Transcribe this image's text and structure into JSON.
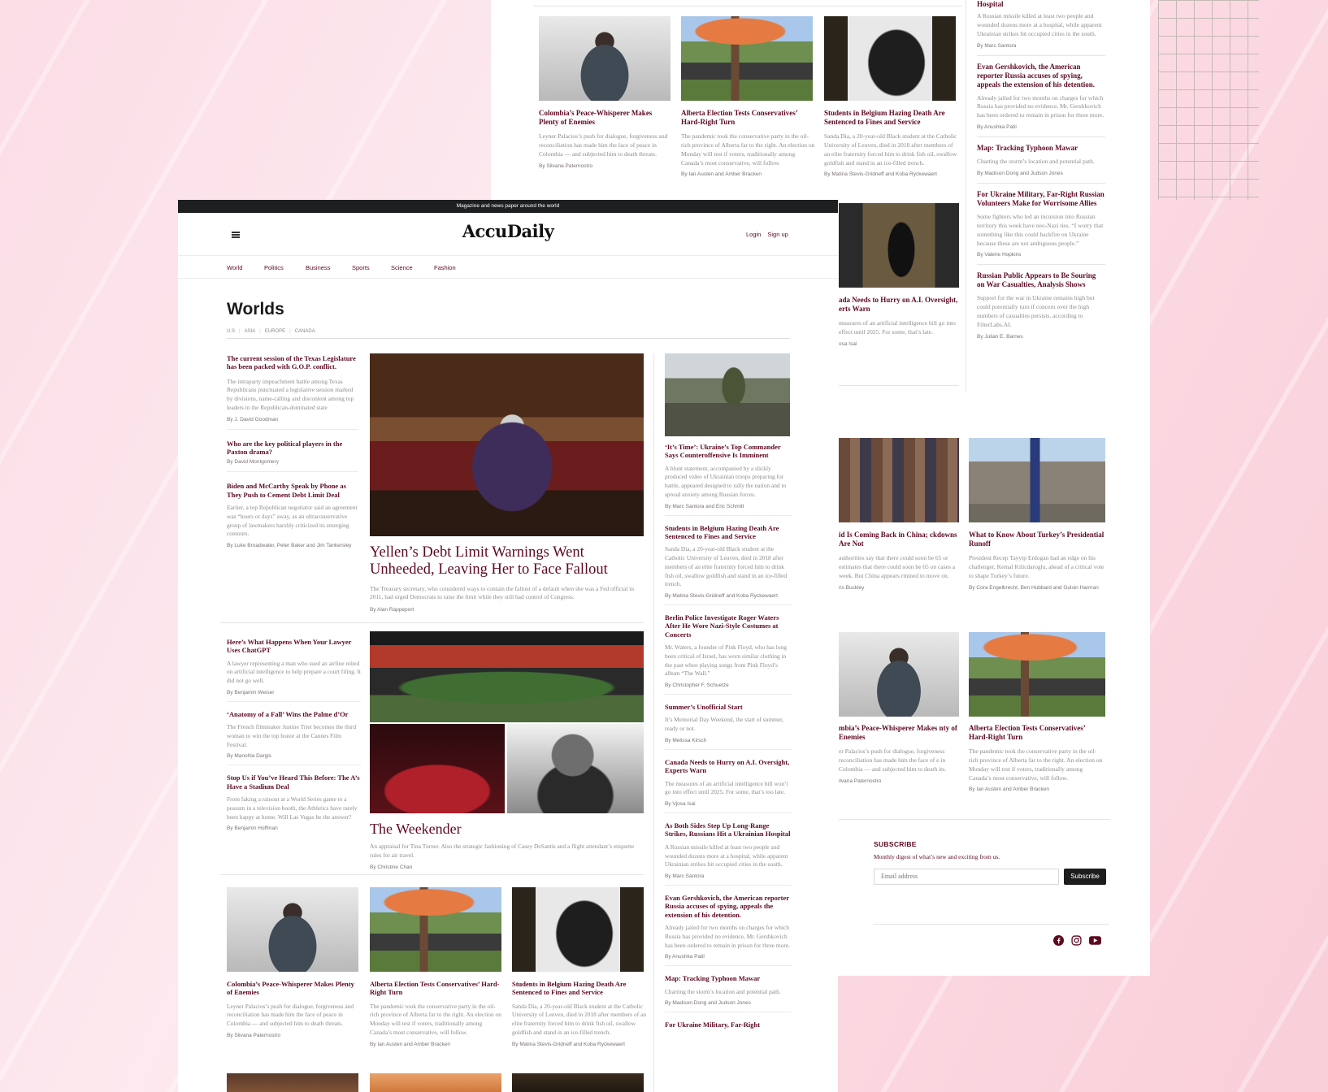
{
  "brand": "AccuDaily",
  "topbar": "Magazine and news paper around the world",
  "auth": {
    "login": "Login",
    "signup": "Sign up"
  },
  "nav": [
    "World",
    "Politics",
    "Business",
    "Sports",
    "Science",
    "Fashion"
  ],
  "section": {
    "title": "Worlds",
    "subnav": [
      "U.S",
      "ASIA",
      "EUROPE",
      "CANADA"
    ]
  },
  "left_col": [
    {
      "title": "The current session of the Texas Legislature has been packed with G.O.P. conflict.",
      "summary": "The intraparty impeachment battle among Texas Republicans punctuated a legislative session marked by divisions, name-calling and discontent among top leaders in the Republican-dominated state",
      "byline": "By J. David Goodman"
    },
    {
      "title": "Who are the key political players in the Paxton drama?",
      "summary": "",
      "byline": "By David Montgomery"
    },
    {
      "title": "Biden and McCarthy Speak by Phone as They Push to Cement Debt Limit Deal",
      "summary": "Earlier, a top Republican negotiator said an agreement was “hours or days” away, as an ultraconservative group of lawmakers harshly criticized its emerging contours.",
      "byline": "By Luke Broadwater, Peter Baker and Jim Tankersley"
    }
  ],
  "lead": {
    "title": "Yellen’s Debt Limit Warnings Went Unheeded, Leaving Her to Face Fallout",
    "summary": "The Treasury secretary, who considered ways to contain the fallout of a default when she was a Fed official in 2011, had urged Democrats to raise the limit while they still had control of Congress.",
    "byline": "By Alan Rappeport"
  },
  "left_col2": [
    {
      "title": "Here’s What Happens When Your Lawyer Uses ChatGPT",
      "summary": "A lawyer representing a man who sued an airline relied on artificial intelligence to help prepare a court filing. It did not go well.",
      "byline": "By Benjamin Weiser"
    },
    {
      "title": "‘Anatomy of a Fall’ Wins the Palme d’Or",
      "summary": "The French filmmaker Justine Triet becomes the third woman to win the top honor at the Cannes Film Festival.",
      "byline": "By Manohla Dargis"
    },
    {
      "title": "Stop Us if You’ve Heard This Before: The A’s Have a Stadium Deal",
      "summary": "From faking a rainout at a World Series game to a possum in a television booth, the Athletics have rarely been happy at home. Will Las Vegas be the answer?",
      "byline": "By Benjamin Hoffman"
    }
  ],
  "weekender": {
    "title": "The Weekender",
    "summary": "An appraisal for Tina Turner. Also the strategic fashioning of Casey DeSantis and a flight attendant’s etiquette rules for air travel.",
    "byline": "By Christine Chan"
  },
  "right_col": [
    {
      "title": "‘It’s Time’: Ukraine’s Top Commander Says Counteroffensive Is Imminent",
      "summary": "A blunt statement, accompanied by a slickly produced video of Ukrainian troops preparing for battle, appeared designed to rally the nation and to spread anxiety among Russian forces.",
      "byline": "By Marc Santora and Eric Schmitt"
    },
    {
      "title": "Students in Belgium Hazing Death Are Sentenced to Fines and Service",
      "summary": "Sanda Dia, a 20-year-old Black student at the Catholic University of Leuven, died in 2018 after members of an elite fraternity forced him to drink fish oil, swallow goldfish and stand in an ice-filled trench.",
      "byline": "By Matina Stevis-Gridneff and Koba Ryckewaert"
    },
    {
      "title": "Berlin Police Investigate Roger Waters After He Wore Nazi-Style Costumes at Concerts",
      "summary": "Mr. Waters, a founder of Pink Floyd, who has long been critical of Israel, has worn similar clothing in the past when playing songs from Pink Floyd’s album “The Wall.”",
      "byline": "By Christopher F. Schuetze"
    },
    {
      "title": "Summer’s Unofficial Start",
      "summary": "It’s Memorial Day Weekend, the start of summer, ready or not.",
      "byline": "By Melissa Kirsch"
    },
    {
      "title": "Canada Needs to Hurry on A.I. Oversight, Experts Warn",
      "summary": "The measures of an artificial intelligence bill won’t go into effect until 2025. For some, that’s too late.",
      "byline": "By Vjosa Isai"
    },
    {
      "title": "As Both Sides Step Up Long-Range Strikes, Russians Hit a Ukrainian Hospital",
      "summary": "A Russian missile killed at least two people and wounded dozens more at a hospital, while apparent Ukrainian strikes hit occupied cities in the south.",
      "byline": "By Marc Santora"
    },
    {
      "title": "Evan Gershkovich, the American reporter Russia accuses of spying, appeals the extension of his detention.",
      "summary": "Already jailed for two months on charges for which Russia has provided no evidence, Mr. Gershkovich has been ordered to remain in prison for three more.",
      "byline": "By Anushka Patil"
    },
    {
      "title": "Map: Tracking Typhoon Mawar",
      "summary": "Charting the storm’s location and potential path.",
      "byline": "By Madison Dong and Judson Jones"
    },
    {
      "title": "For Ukraine Military, Far-Right",
      "summary": "",
      "byline": ""
    }
  ],
  "bottom_cards": [
    {
      "title": "Colombia’s Peace-Whisperer Makes Plenty of Enemies",
      "summary": "Leyner Palacios’s push for dialogue, forgiveness and reconciliation has made him the face of peace in Colombia — and subjected him to death threats.",
      "byline": "By Silvana Paternostro"
    },
    {
      "title": "Alberta Election Tests Conservatives’ Hard-Right Turn",
      "summary": "The pandemic took the conservative party in the oil-rich province of Alberta far to the right. An election on Monday will test if voters, traditionally among Canada’s most conservative, will follow.",
      "byline": "By Ian Austen and Amber Bracken"
    },
    {
      "title": "Students in Belgium Hazing Death Are Sentenced to Fines and Service",
      "summary": "Sanda Dia, a 20-year-old Black student at the Catholic University of Leuven, died in 2018 after members of an elite fraternity forced him to drink fish oil, swallow goldfish and stand in an ice-filled trench.",
      "byline": "By Matina Stevis-Gridneff and Koba Ryckewaert"
    }
  ],
  "bg_right_col": [
    {
      "title": "Hospital",
      "summary": "A Russian missile killed at least two people and wounded dozens more at a hospital, while apparent Ukrainian strikes hit occupied cities in the south.",
      "byline": "By Marc Santora"
    },
    {
      "title": "Evan Gershkovich, the American reporter Russia accuses of spying, appeals the extension of his detention.",
      "summary": "Already jailed for two months on charges for which Russia has provided no evidence, Mr. Gershkovich has been ordered to remain in prison for three more.",
      "byline": "By Anushka Patil"
    },
    {
      "title": "Map: Tracking Typhoon Mawar",
      "summary": "Charting the storm’s location and potential path.",
      "byline": "By Madison Dong and Judson Jones"
    },
    {
      "title": "For Ukraine Military, Far-Right Russian Volunteers Make for Worrisome Allies",
      "summary": "Some fighters who led an incursion into Russian territory this week have neo-Nazi ties. “I worry that something like this could backfire on Ukraine because these are not ambiguous people.”",
      "byline": "By Valerie Hopkins"
    },
    {
      "title": "Russian Public Appears to Be Souring on War Casualties, Analysis Shows",
      "summary": "Support for the war in Ukraine remains high but could potentially turn if concern over the high numbers of casualties persists, according to FilterLabs.AI.",
      "byline": "By Julian E. Barnes"
    }
  ],
  "bg_partial": {
    "title": "ada Needs to Hurry on A.I. Oversight, erts Warn",
    "summary": "measures of an artificial intelligence bill go into effect until 2025. For some, that’s late.",
    "byline": "osa Isai"
  },
  "bg_china": {
    "title": "id Is Coming Back in China; ckdowns Are Not",
    "summary": "authorities say that there could soon be 65 or estimates that there could soon be 65 on cases a week. But China appears rmined to move on.",
    "byline": "ris Buckley"
  },
  "bg_turkey": {
    "title": "What to Know About Turkey’s Presidential Runoff",
    "summary": "President Recep Tayyip Erdogan had an edge on his challenger, Kemal Kilicdaroglu, ahead of a critical vote to shape Turkey’s future.",
    "byline": "By Cora Engelbrecht, Ben Hubbard and Gulsin Harman"
  },
  "bg_colombia": {
    "title": "mbia’s Peace-Whisperer Makes nty of Enemies",
    "summary": "er Palacios’s push for dialogue, forgiveness reconciliation has made him the face of e in Colombia — and subjected him to death its.",
    "byline": "ilvana Paternostro"
  },
  "subscribe": {
    "heading": "SUBSCRIBE",
    "text": "Monthly digest of what’s new and exciting from us.",
    "placeholder": "Email address",
    "button": "Subscribe"
  },
  "social": [
    "facebook-icon",
    "instagram-icon",
    "youtube-icon"
  ]
}
